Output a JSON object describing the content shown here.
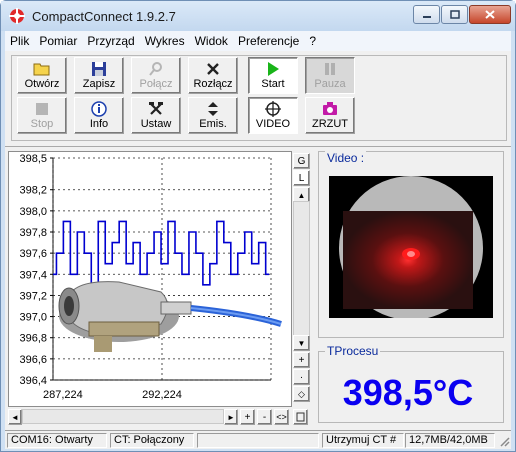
{
  "window": {
    "title": "CompactConnect 1.9.2.7"
  },
  "menu": [
    "Plik",
    "Pomiar",
    "Przyrząd",
    "Wykres",
    "Widok",
    "Preferencje",
    "?"
  ],
  "toolbar": {
    "row1": [
      {
        "label": "Otwórz",
        "icon": "folder-icon",
        "enabled": true
      },
      {
        "label": "Zapisz",
        "icon": "floppy-icon",
        "enabled": true
      },
      {
        "label": "Połącz",
        "icon": "connect-icon",
        "enabled": false
      },
      {
        "label": "Rozłącz",
        "icon": "disconnect-icon",
        "enabled": true
      },
      {
        "label": "Start",
        "icon": "play-icon",
        "enabled": true
      },
      {
        "label": "Pauza",
        "icon": "pause-icon",
        "enabled": false
      }
    ],
    "row2": [
      {
        "label": "Stop",
        "icon": "stop-icon",
        "enabled": false
      },
      {
        "label": "Info",
        "icon": "info-icon",
        "enabled": true
      },
      {
        "label": "Ustaw",
        "icon": "tools-icon",
        "enabled": true
      },
      {
        "label": "Emis.",
        "icon": "emissivity-icon",
        "enabled": true
      },
      {
        "label": "VIDEO",
        "icon": "crosshair-icon",
        "enabled": true
      },
      {
        "label": "ZRZUT",
        "icon": "camera-icon",
        "enabled": true
      }
    ]
  },
  "chart_side": {
    "g_label": "G",
    "l_label": "L",
    "up": "▲",
    "down": "▼",
    "plus": "+",
    "dot": "·",
    "minus": "-",
    "fit": "◇"
  },
  "hscroll": {
    "left": "◄",
    "right": "►",
    "plus": "+",
    "minus": "-",
    "fit": "<>"
  },
  "video": {
    "title": "Video :"
  },
  "tprocess": {
    "title": "TProcesu",
    "value": "398,5°C"
  },
  "status": {
    "port": "COM16: Otwarty",
    "ct": "CT: Połączony",
    "hold": "Utrzymuj CT #",
    "memory": "12,7MB/42,0MB"
  },
  "colors": {
    "series": "#0000d0",
    "temp_text": "#0a00f0",
    "group_title": "#0a2a9c"
  },
  "chart_data": {
    "type": "line",
    "title": "",
    "xlabel": "",
    "ylabel": "",
    "ylim": [
      396.4,
      398.5
    ],
    "xlim": [
      287.224,
      297.224
    ],
    "yticks": [
      "398,5",
      "398,2",
      "398,0",
      "397,8",
      "397,6",
      "397,4",
      "397,2",
      "397,0",
      "396,8",
      "396,6",
      "396,4"
    ],
    "xticks": [
      "287,224",
      "292,224"
    ],
    "grid": true,
    "series": [
      {
        "name": "",
        "x": [
          287.224,
          287.54,
          287.86,
          288.18,
          288.5,
          288.82,
          289.14,
          289.46,
          289.78,
          290.1,
          290.42,
          290.74,
          291.06,
          291.38,
          291.7,
          292.02,
          292.34,
          292.66,
          292.98,
          293.3,
          293.62,
          293.94,
          294.26,
          294.58,
          294.9,
          295.22,
          295.54,
          295.86,
          296.18,
          296.5,
          296.82,
          297.14
        ],
        "values": [
          397.4,
          397.6,
          397.9,
          397.4,
          397.8,
          397.6,
          397.3,
          397.9,
          397.5,
          397.7,
          397.9,
          397.5,
          397.7,
          397.4,
          397.6,
          397.8,
          397.5,
          397.9,
          397.6,
          397.4,
          397.8,
          397.6,
          397.3,
          397.5,
          397.9,
          397.7,
          397.4,
          397.6,
          397.8,
          397.5,
          397.7,
          397.4
        ]
      }
    ]
  }
}
